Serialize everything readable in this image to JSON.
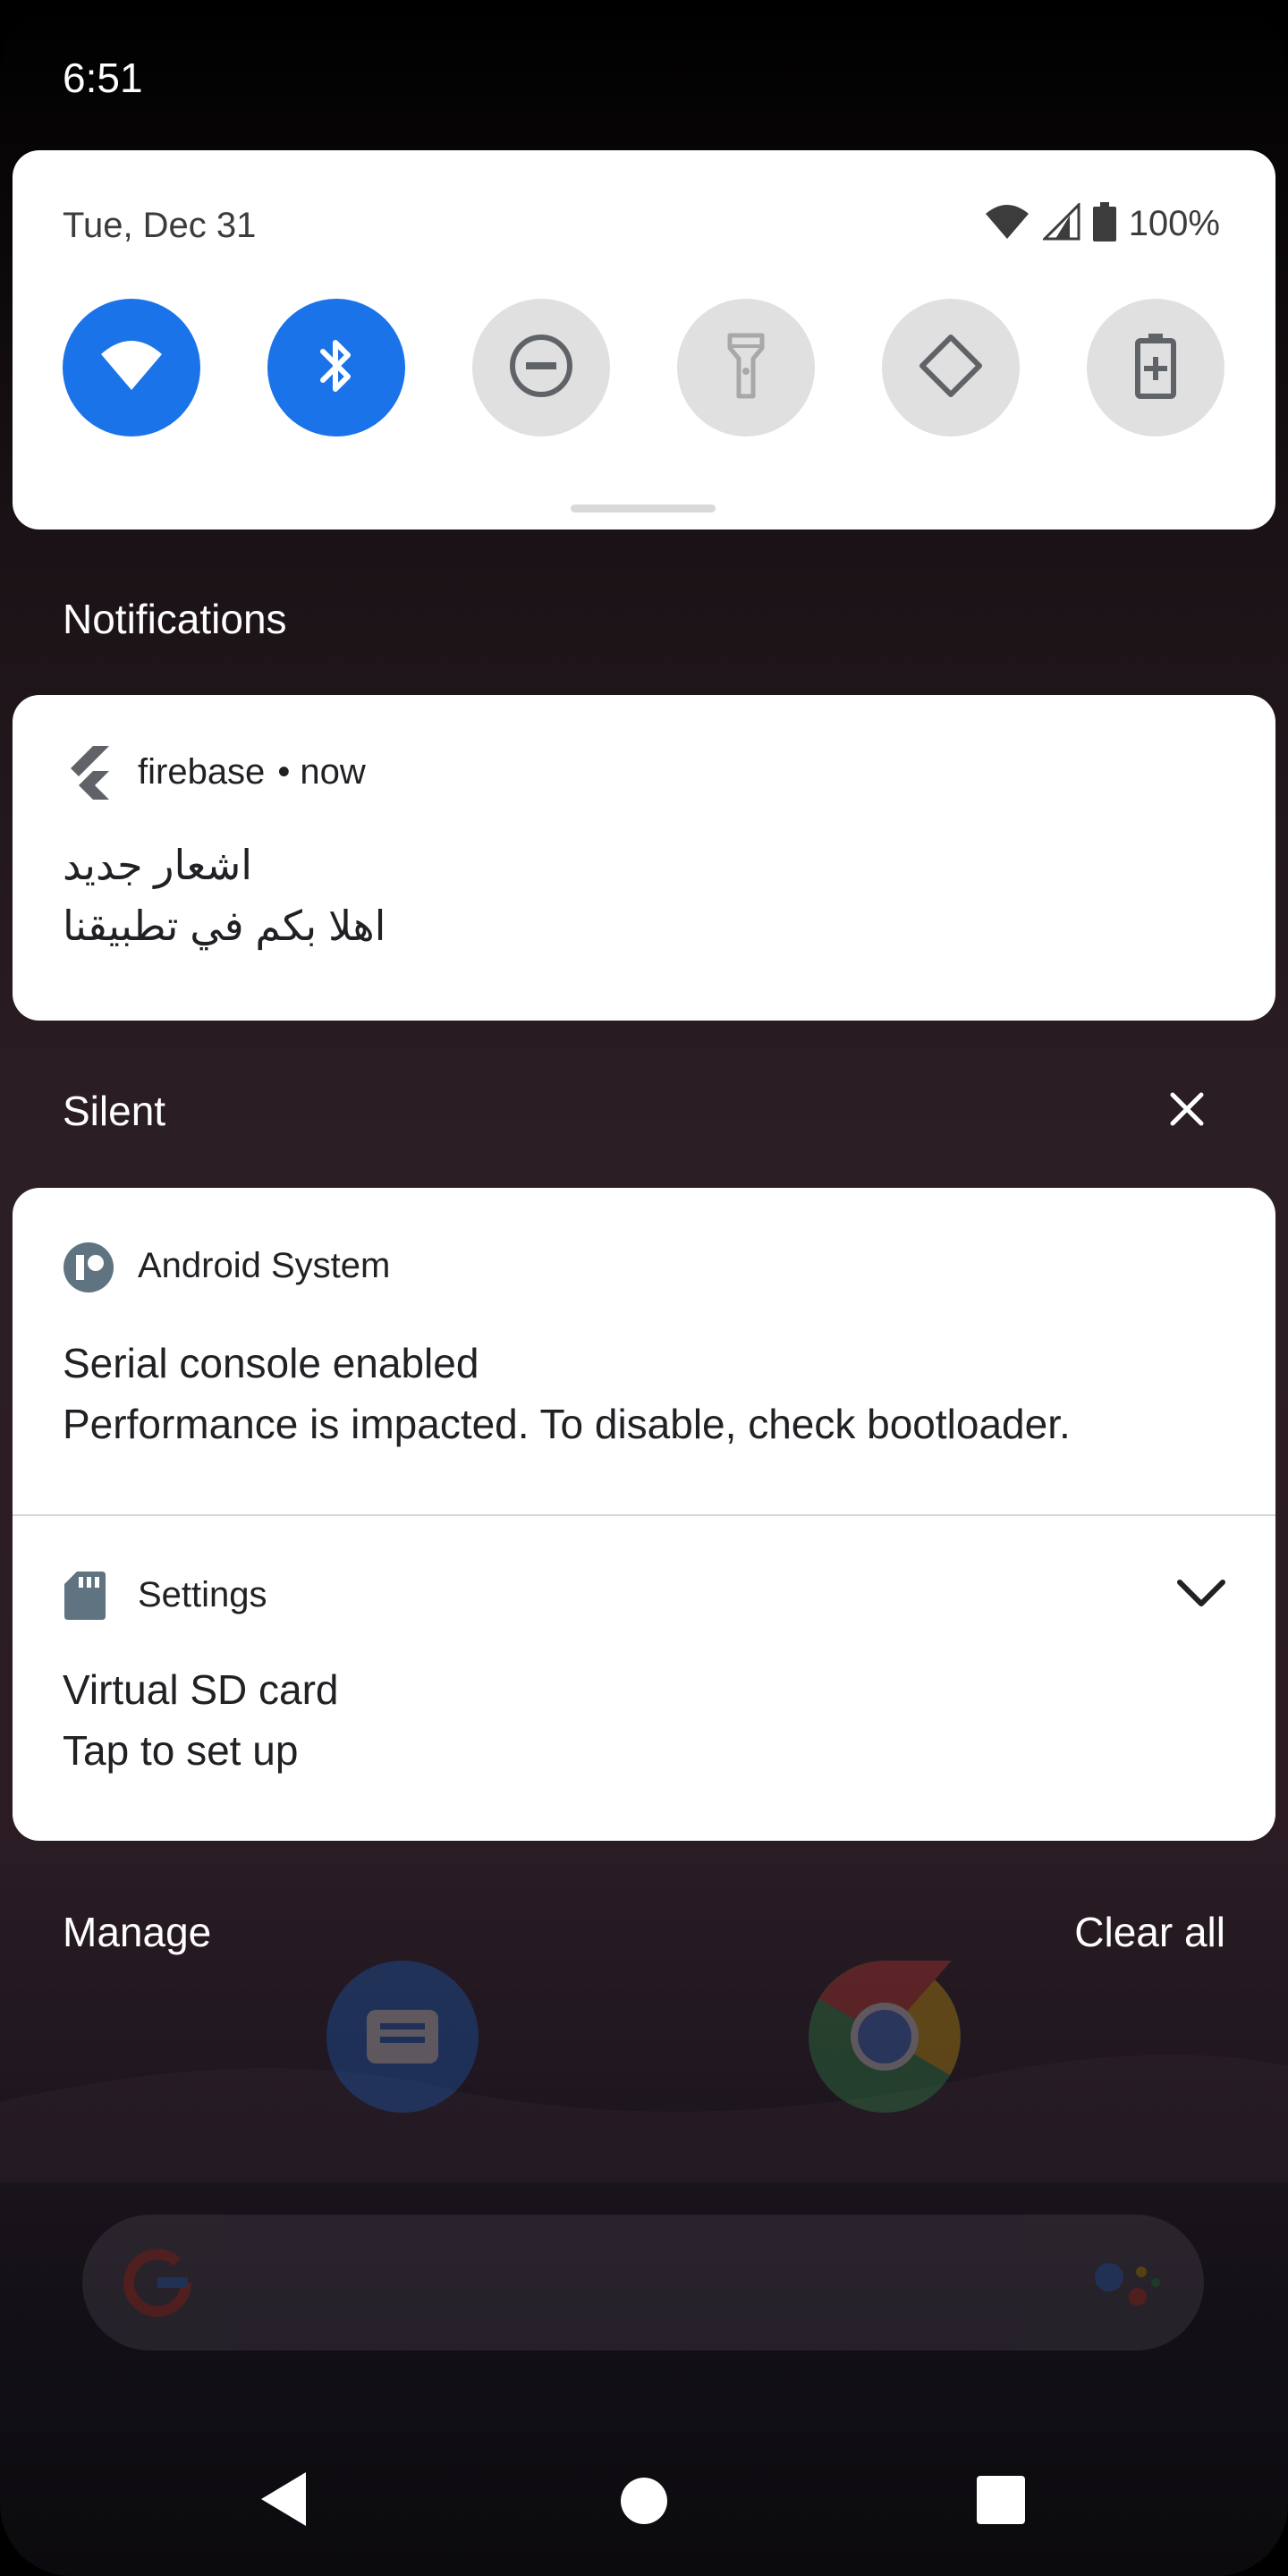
{
  "status_bar": {
    "time": "6:51"
  },
  "quick_settings": {
    "date": "Tue, Dec 31",
    "battery_percent": "100%",
    "tiles": [
      {
        "name": "wifi-icon",
        "state": "on"
      },
      {
        "name": "bluetooth-icon",
        "state": "on"
      },
      {
        "name": "do-not-disturb-icon",
        "state": "off"
      },
      {
        "name": "flashlight-icon",
        "state": "off"
      },
      {
        "name": "auto-rotate-icon",
        "state": "off"
      },
      {
        "name": "battery-saver-icon",
        "state": "off"
      }
    ]
  },
  "notifications_header": "Notifications",
  "firebase_notification": {
    "app": "firebase",
    "time": "• now",
    "title": "اشعار جديد",
    "body": "اهلا بكم في تطبيقنا"
  },
  "silent_section": {
    "label": "Silent"
  },
  "android_system_notification": {
    "app": "Android System",
    "title": "Serial console enabled",
    "body": "Performance is impacted. To disable, check bootloader."
  },
  "settings_notification": {
    "app": "Settings",
    "title": "Virtual SD card",
    "body": "Tap to set up"
  },
  "footer": {
    "manage": "Manage",
    "clear_all": "Clear all"
  },
  "colors": {
    "accent": "#1a73e8",
    "tile_off": "#e0e0e0",
    "card": "#ffffff"
  }
}
